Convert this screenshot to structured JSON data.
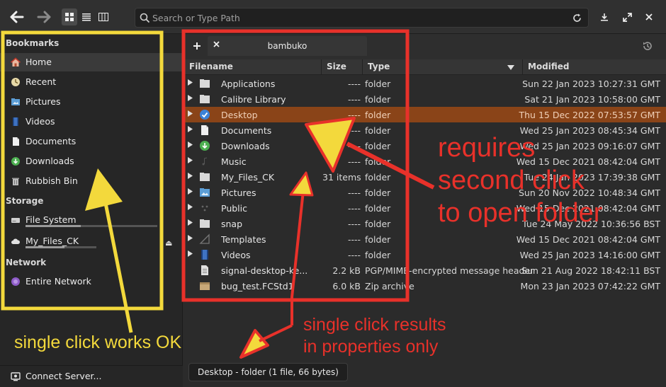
{
  "header": {
    "path_placeholder": "Search or Type Path",
    "path_value": ""
  },
  "sidebar": {
    "bookmarks_heading": "Bookmarks",
    "bookmarks": [
      {
        "label": "Home",
        "icon": "home-icon"
      },
      {
        "label": "Recent",
        "icon": "recent-icon"
      },
      {
        "label": "Pictures",
        "icon": "pictures-folder-icon"
      },
      {
        "label": "Videos",
        "icon": "videos-folder-icon"
      },
      {
        "label": "Documents",
        "icon": "documents-folder-icon"
      },
      {
        "label": "Downloads",
        "icon": "downloads-folder-icon"
      },
      {
        "label": "Rubbish Bin",
        "icon": "trash-icon"
      }
    ],
    "storage_heading": "Storage",
    "storage": [
      {
        "label": "File System",
        "icon": "drive-icon",
        "usage_fraction": 0.42
      },
      {
        "label": "My_Files_CK",
        "icon": "cloud-icon",
        "usage_fraction": 0.55
      }
    ],
    "network_heading": "Network",
    "network": [
      {
        "label": "Entire Network",
        "icon": "network-icon"
      }
    ],
    "connect_server_label": "Connect Server..."
  },
  "tab": {
    "label": "bambuko"
  },
  "columns": {
    "filename": "Filename",
    "size": "Size",
    "type": "Type",
    "modified": "Modified"
  },
  "files": [
    {
      "name": "Applications",
      "size": "----",
      "type": "folder",
      "modified": "Sun 22 Jan 2023 10:27:31 GMT",
      "icon": "folder-icon",
      "expandable": true
    },
    {
      "name": "Calibre Library",
      "size": "----",
      "type": "folder",
      "modified": "Sat 21 Jan 2023 10:58:00 GMT",
      "icon": "folder-icon",
      "expandable": true
    },
    {
      "name": "Desktop",
      "size": "----",
      "type": "folder",
      "modified": "Thu 15 Dec 2022 07:53:57 GMT",
      "icon": "desktop-folder-icon",
      "expandable": true,
      "selected": true
    },
    {
      "name": "Documents",
      "size": "----",
      "type": "folder",
      "modified": "Wed 25 Jan 2023 08:45:34 GMT",
      "icon": "documents-folder-icon",
      "expandable": true
    },
    {
      "name": "Downloads",
      "size": "----",
      "type": "folder",
      "modified": "Wed 25 Jan 2023 09:16:07 GMT",
      "icon": "downloads-folder-icon",
      "expandable": true
    },
    {
      "name": "Music",
      "size": "----",
      "type": "folder",
      "modified": "Wed 15 Dec 2021 08:42:04 GMT",
      "icon": "music-folder-icon",
      "expandable": true
    },
    {
      "name": "My_Files_CK",
      "size": "31 items",
      "type": "folder",
      "modified": "Tue 24 Jan 2023 17:39:38 GMT",
      "icon": "folder-icon",
      "expandable": true
    },
    {
      "name": "Pictures",
      "size": "----",
      "type": "folder",
      "modified": "Sun 20 Nov 2022 10:48:34 GMT",
      "icon": "pictures-folder-icon",
      "expandable": true
    },
    {
      "name": "Public",
      "size": "----",
      "type": "folder",
      "modified": "Wed 15 Dec 2021 08:42:04 GMT",
      "icon": "public-folder-icon",
      "expandable": true
    },
    {
      "name": "snap",
      "size": "----",
      "type": "folder",
      "modified": "Tue 24 May 2022 10:36:56 BST",
      "icon": "folder-icon",
      "expandable": true
    },
    {
      "name": "Templates",
      "size": "----",
      "type": "folder",
      "modified": "Wed 15 Dec 2021 08:42:04 GMT",
      "icon": "templates-folder-icon",
      "expandable": true
    },
    {
      "name": "Videos",
      "size": "----",
      "type": "folder",
      "modified": "Wed 25 Jan 2023 14:16:00 GMT",
      "icon": "videos-folder-icon",
      "expandable": true
    },
    {
      "name": "signal-desktop-ke...",
      "size": "2.2 kB",
      "type": "PGP/MIME-encrypted message header",
      "modified": "Sun 21 Aug 2022 18:42:11 BST",
      "icon": "text-file-icon",
      "expandable": false
    },
    {
      "name": "bug_test.FCStd1",
      "size": "6.0 kB",
      "type": "Zip archive",
      "modified": "Mon 23 Jan 2023 07:42:22 GMT",
      "icon": "archive-icon",
      "expandable": false
    }
  ],
  "status_text": "Desktop - folder (1 file, 66 bytes)",
  "annotations": {
    "red_big": "requires\nsecond click\nto open folder",
    "red_small": "single click results\nin properties only",
    "yellow": "single click works OK",
    "red_color": "#e8312a",
    "yellow_color": "#f3d93c"
  },
  "colors": {
    "selection": "#8a4418",
    "background": "#2b2b2b"
  }
}
